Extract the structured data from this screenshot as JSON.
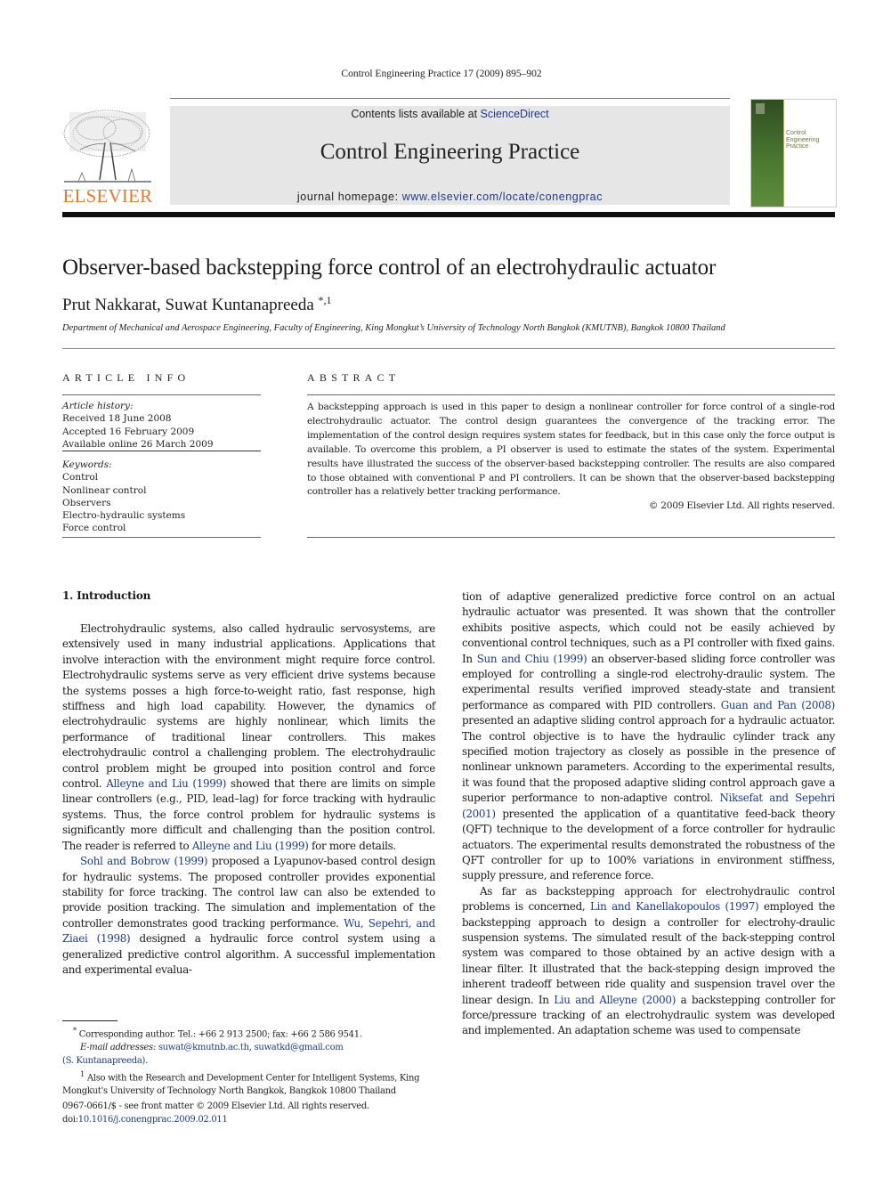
{
  "running_head": "Control Engineering Practice 17 (2009) 895–902",
  "publisher": {
    "logo_word": "ELSEVIER",
    "logo_icon": "elsevier-tree-icon",
    "brand_color": "#e8782c"
  },
  "banner": {
    "contents_prefix": "Contents lists available at ",
    "contents_link": "ScienceDirect",
    "journal_title": "Control Engineering Practice",
    "homepage_prefix": "journal homepage: ",
    "homepage_link": "www.elsevier.com/locate/conengprac"
  },
  "cover": {
    "title_lines": [
      "Control",
      "Engineering",
      "Practice"
    ],
    "accent_color": "#4c7a32"
  },
  "article": {
    "title": "Observer-based backstepping force control of an electrohydraulic actuator",
    "authors": "Prut Nakkarat, Suwat Kuntanapreeda",
    "author_marks": "*,1",
    "affiliation": "Department of Mechanical and Aerospace Engineering, Faculty of Engineering, King Mongkut’s University of Technology North Bangkok (KMUTNB), Bangkok 10800 Thailand"
  },
  "article_info": {
    "heading": "ARTICLE INFO",
    "history_label": "Article history:",
    "history": [
      "Received 18 June 2008",
      "Accepted 16 February 2009",
      "Available online 26 March 2009"
    ],
    "keywords_label": "Keywords:",
    "keywords": [
      "Control",
      "Nonlinear control",
      "Observers",
      "Electro-hydraulic systems",
      "Force control"
    ]
  },
  "abstract": {
    "heading": "ABSTRACT",
    "text": "A backstepping approach is used in this paper to design a nonlinear controller for force control of a single-rod electrohydraulic actuator. The control design guarantees the convergence of the tracking error. The implementation of the control design requires system states for feedback, but in this case only the force output is available. To overcome this problem, a PI observer is used to estimate the states of the system. Experimental results have illustrated the success of the observer-based backstepping controller. The results are also compared to those obtained with conventional P and PI controllers. It can be shown that the observer-based backstepping controller has a relatively better tracking performance.",
    "copyright": "© 2009 Elsevier Ltd. All rights reserved."
  },
  "body": {
    "section_heading": "1.  Introduction",
    "left": {
      "p1_a": "Electrohydraulic systems, also called hydraulic servosystems, are extensively used in many industrial applications. Applications that involve interaction with the environment might require force control. Electrohydraulic systems serve as very efficient drive systems because the systems posses a high force-to-weight ratio, fast response, high stiffness and high load capability. However, the dynamics of electrohydraulic systems are highly nonlinear, which limits the performance of traditional linear controllers. This makes electrohydraulic control a challenging problem. The electrohydraulic control problem might be grouped into position control and force control. ",
      "p1_link1": "Alleyne and Liu (1999)",
      "p1_b": " showed that there are limits on simple linear controllers (e.g., PID, lead–lag) for force tracking with hydraulic systems. Thus, the force control problem for hydraulic systems is significantly more difficult and challenging than the position control. The reader is referred to ",
      "p1_link2": "Alleyne and Liu (1999)",
      "p1_c": " for more details.",
      "p2_link1": "Sohl and Bobrow (1999)",
      "p2_a": " proposed a Lyapunov-based control design for hydraulic systems. The proposed controller provides exponential stability for force tracking. The control law can also be extended to provide position tracking. The simulation and implementation of the controller demonstrates good tracking performance. ",
      "p2_link2": "Wu, Sepehri, and Ziaei (1998)",
      "p2_b": " designed a hydraulic force control system using a generalized predictive control algorithm. A successful implementation and experimental evalua-"
    },
    "right": {
      "p1_a": "tion of adaptive generalized predictive force control on an actual hydraulic actuator was presented. It was shown that the controller exhibits positive aspects, which could not be easily achieved by conventional control techniques, such as a PI controller with fixed gains. In ",
      "p1_link1": "Sun and Chiu (1999)",
      "p1_b": " an observer-based sliding force controller was employed for controlling a single-rod electrohy-draulic system. The experimental results verified improved steady-state and transient performance as compared with PID controllers. ",
      "p1_link2": "Guan and Pan (2008)",
      "p1_c": " presented an adaptive sliding control approach for a hydraulic actuator. The control objective is to have the hydraulic cylinder track any specified motion trajectory as closely as possible in the presence of nonlinear unknown parameters. According to the experimental results, it was found that the proposed adaptive sliding control approach gave a superior performance to non-adaptive control. ",
      "p1_link3": "Niksefat and Sepehri (2001)",
      "p1_d": " presented the application of a quantitative feed-back theory (QFT) technique to the development of a force controller for hydraulic actuators. The experimental results demonstrated the robustness of the QFT controller for up to 100% variations in environment stiffness, supply pressure, and reference force.",
      "p2_a": "As far as backstepping approach for electrohydraulic control problems is concerned, ",
      "p2_link1": "Lin and Kanellakopoulos (1997)",
      "p2_b": " employed the backstepping approach to design a controller for electrohy-draulic suspension systems. The simulated result of the back-stepping control system was compared to those obtained by an active design with a linear filter. It illustrated that the back-stepping design improved the inherent tradeoff between ride quality and suspension travel over the linear design. In ",
      "p2_link2": "Liu and Alleyne (2000)",
      "p2_c": " a backstepping controller for force/pressure tracking of an electrohydraulic system was developed and implemented. An adaptation scheme was used to compensate"
    }
  },
  "footnotes": {
    "corresponding_mark": "*",
    "corresponding": " Corresponding author. Tel.: +66 2 913 2500; fax: +66 2 586 9541.",
    "email_label": "E-mail addresses: ",
    "email1": "suwat@kmutnb.ac.th",
    "email_sep": ", ",
    "email2": "suwatkd@gmail.com",
    "email_owner": "(S. Kuntanapreeda).",
    "note1_mark": "1",
    "note1": " Also with the Research and Development Center for Intelligent Systems, King Mongkut's University of Technology North Bangkok, Bangkok 10800 Thailand"
  },
  "front_matter": {
    "issn_line": "0967-0661/$ - see front matter © 2009 Elsevier Ltd. All rights reserved.",
    "doi_prefix": "doi:",
    "doi": "10.1016/j.conengprac.2009.02.011"
  }
}
